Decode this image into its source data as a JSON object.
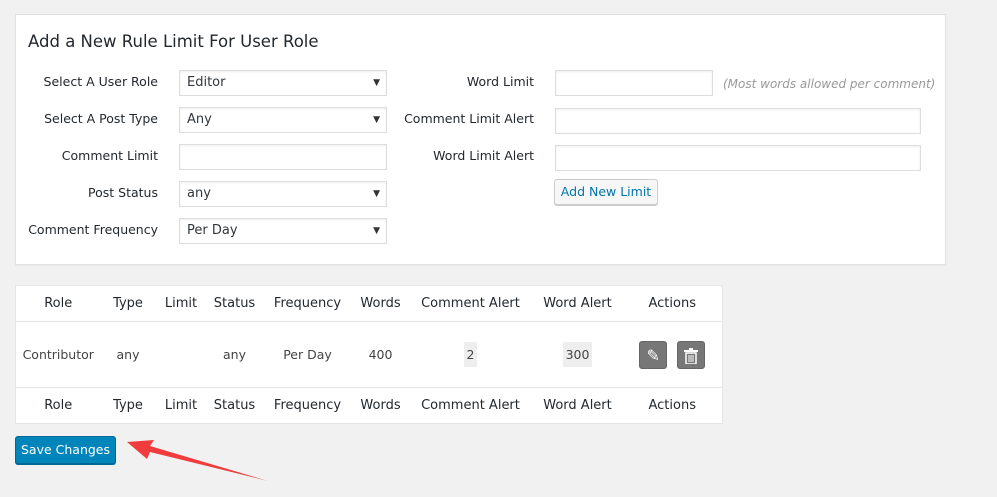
{
  "form": {
    "title": "Add a New Rule Limit For User Role",
    "user_role_label": "Select A User Role",
    "user_role_value": "Editor",
    "post_type_label": "Select A Post Type",
    "post_type_value": "Any",
    "comment_limit_label": "Comment Limit",
    "comment_limit_value": "",
    "post_status_label": "Post Status",
    "post_status_value": "any",
    "frequency_label": "Comment Frequency",
    "frequency_value": "Per Day",
    "word_limit_label": "Word Limit",
    "word_limit_value": "",
    "word_limit_hint": "(Most words allowed per comment)",
    "comment_alert_label": "Comment Limit Alert",
    "comment_alert_value": "",
    "word_alert_label": "Word Limit Alert",
    "word_alert_value": "",
    "add_button": "Add New Limit",
    "dropdown_glyph": "▼"
  },
  "table": {
    "headers": [
      "Role",
      "Type",
      "Limit",
      "Status",
      "Frequency",
      "Words",
      "Comment Alert",
      "Word Alert",
      "Actions"
    ],
    "rows": [
      {
        "role": "Contributor",
        "type": "any",
        "limit": "",
        "status": "any",
        "frequency": "Per Day",
        "words": "400",
        "comment_alert": "2",
        "word_alert": "300"
      }
    ]
  },
  "save_button": "Save Changes",
  "colors": {
    "primary": "#0085ba",
    "arrow": "#f03c3c"
  }
}
